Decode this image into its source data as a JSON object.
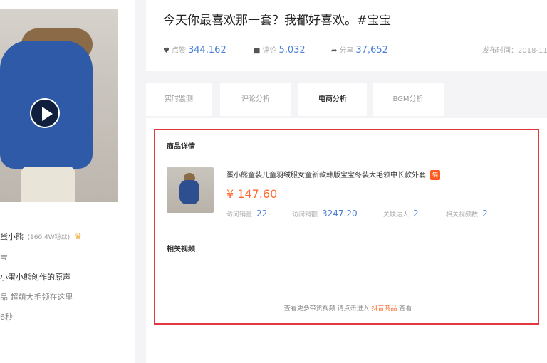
{
  "video": {
    "title": "今天你最喜欢那一套？我都好喜欢。#宝宝",
    "stats": {
      "likes_label": "点赞",
      "likes": "344,162",
      "comments_label": "评论",
      "comments": "5,032",
      "shares_label": "分享",
      "shares": "37,652"
    },
    "publish_time": "发布时间：2018-11"
  },
  "author": {
    "name": "蛋小熊",
    "fans": "(160.4W粉丝)",
    "line1": "宝",
    "line2": "小蛋小熊创作的原声",
    "line3": "品   超萌大毛领在这里",
    "line4": "6秒"
  },
  "tabs": [
    {
      "label": "实时监测",
      "active": false
    },
    {
      "label": "评论分析",
      "active": false
    },
    {
      "label": "电商分析",
      "active": true
    },
    {
      "label": "BGM分析",
      "active": false
    }
  ],
  "product_section": {
    "title": "商品详情",
    "product": {
      "name": "蛋小熊童装儿童羽绒服女童新款韩版宝宝冬装大毛领中长款外套",
      "badge": "天猫",
      "price": "¥ 147.60",
      "metrics": [
        {
          "label": "访问销量",
          "value": "22"
        },
        {
          "label": "访问销额",
          "value": "3247.20"
        },
        {
          "label": "关联达人",
          "value": "2"
        },
        {
          "label": "相关视频数",
          "value": "2"
        }
      ]
    }
  },
  "related_section": {
    "title": "相关视频",
    "note_prefix": "查看更多带货视频 请点击进入 ",
    "note_link": "抖音商品",
    "note_suffix": " 查看"
  }
}
